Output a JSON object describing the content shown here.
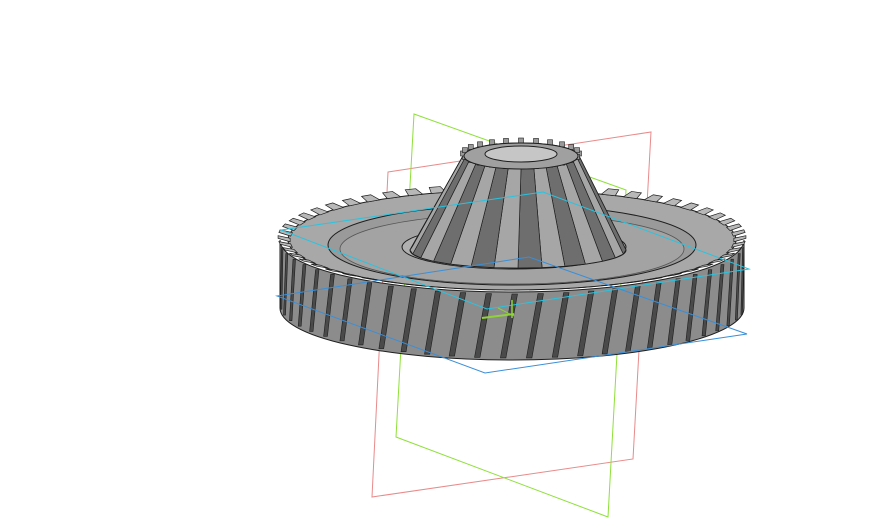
{
  "viewport": {
    "background": "#ffffff",
    "model": {
      "kind": "combined helical spur gear with tapered pinion",
      "body_color": "#8c8c8c",
      "face_color": "#a8a8a8",
      "dark_color": "#4a4a4a",
      "edge_color": "#1e1e1e",
      "large_gear_teeth": 56,
      "pinion_teeth": 14
    },
    "planes": {
      "front_color": "#e88a8a",
      "right_color": "#8fe03a",
      "top_color": "#28c4e0",
      "inner_color": "#3a8fd8"
    },
    "origin_color": "#8fd23a"
  }
}
